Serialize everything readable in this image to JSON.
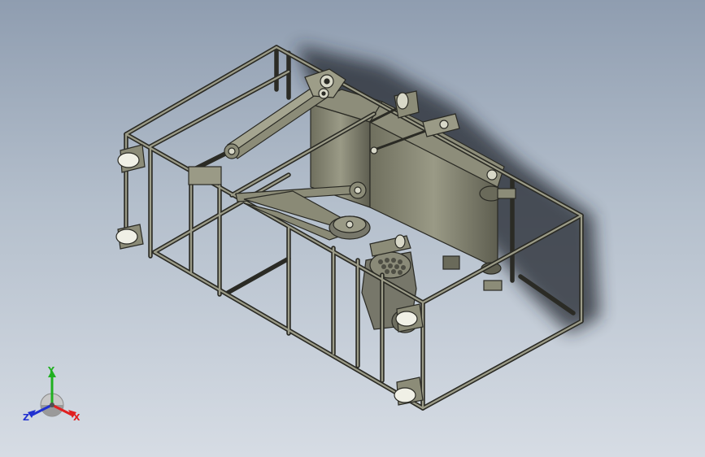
{
  "viewport": {
    "background_top": "#8f9db0",
    "background_bottom": "#d6dce4",
    "model_color": "#7a7a6a",
    "edge_color": "#2a2a24",
    "shadow_color": "#22262e"
  },
  "triad": {
    "icon": "axis-triad-icon",
    "x_label": "X",
    "y_label": "Y",
    "z_label": "Z",
    "x_color": "#e02020",
    "y_color": "#20b020",
    "z_color": "#2030d0"
  }
}
